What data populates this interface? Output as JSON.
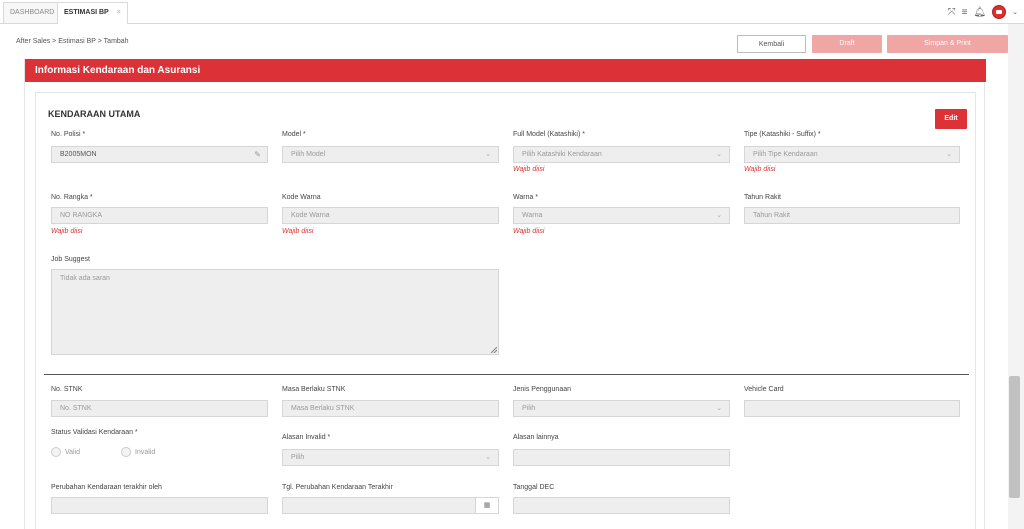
{
  "tabs": [
    {
      "label": "DASHBOARD"
    },
    {
      "label": "ESTIMASI BP",
      "close": "×"
    }
  ],
  "header_icons": [
    "fullscreen-icon",
    "menu-icon",
    "bell-icon",
    "avatar-icon",
    "chevron-down-icon"
  ],
  "breadcrumb": "After Sales > Estimasi BP > Tambah",
  "actions": {
    "kembali": "Kembali",
    "draft": "Draft",
    "simpan": "Simpan & Print"
  },
  "section_title": "Informasi Kendaraan dan Asuransi",
  "card": {
    "title": "KENDARAAN UTAMA",
    "edit": "Edit"
  },
  "fields": {
    "no_polisi": {
      "label": "No. Polisi *",
      "value": "B2005MON"
    },
    "model": {
      "label": "Model *",
      "placeholder": "Pilih Model"
    },
    "full_model": {
      "label": "Full Model (Katashiki) *",
      "placeholder": "Pilih Katashiki Kendaraan",
      "error": "Wajib diisi"
    },
    "tipe": {
      "label": "Tipe (Katashiki - Suffix) *",
      "placeholder": "Pilih Tipe Kendaraan",
      "error": "Wajib diisi"
    },
    "no_rangka": {
      "label": "No. Rangka *",
      "placeholder": "NO RANGKA",
      "error": "Wajib diisi"
    },
    "kode_warna": {
      "label": "Kode Warna",
      "placeholder": "Kode Warna",
      "error": "Wajib diisi"
    },
    "warna": {
      "label": "Warna *",
      "placeholder": "Warna",
      "error": "Wajib diisi"
    },
    "tahun_rakit": {
      "label": "Tahun Rakit",
      "placeholder": "Tahun Rakit"
    },
    "job_suggest": {
      "label": "Job Suggest",
      "placeholder": "Tidak ada saran"
    },
    "no_stnk": {
      "label": "No. STNK",
      "placeholder": "No. STNK"
    },
    "masa_berlaku": {
      "label": "Masa Berlaku STNK",
      "placeholder": "Masa Berlaku STNK"
    },
    "jenis_penggunaan": {
      "label": "Jenis Penggunaan",
      "placeholder": "Pilih"
    },
    "vehicle_card": {
      "label": "Vehicle Card",
      "value": ""
    },
    "status_validasi": {
      "label": "Status Validasi Kendaraan *",
      "options": [
        "Valid",
        "Invalid"
      ]
    },
    "alasan_invalid": {
      "label": "Alasan Invalid *",
      "placeholder": "Pilih"
    },
    "alasan_lainnya": {
      "label": "Alasan lainnya",
      "value": ""
    },
    "perubahan_oleh": {
      "label": "Perubahan Kendaraan terakhir oleh",
      "value": ""
    },
    "tgl_perubahan": {
      "label": "Tgl. Perubahan Kendaraan Terakhir",
      "value": ""
    },
    "tanggal_dec": {
      "label": "Tanggal DEC",
      "value": ""
    }
  }
}
